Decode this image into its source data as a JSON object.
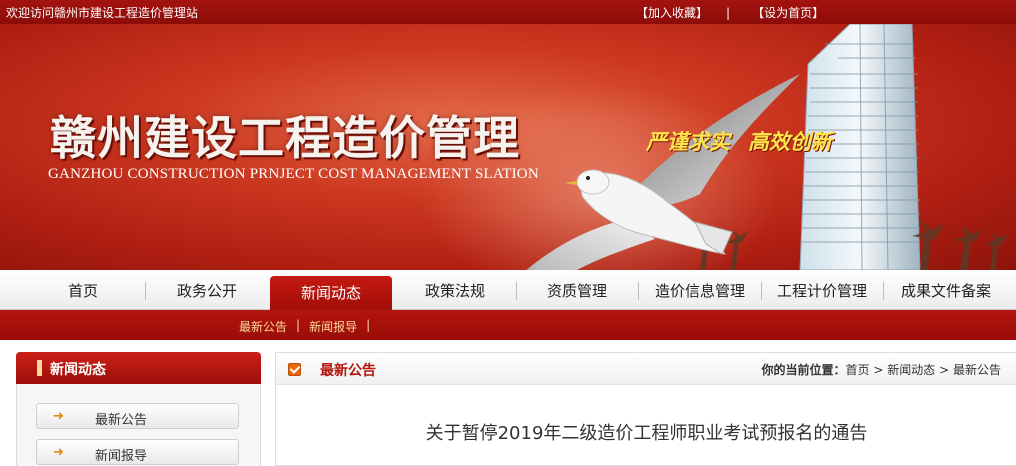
{
  "topbar": {
    "welcome": "欢迎访问赣州市建设工程造价管理站",
    "favorite": "【加入收藏】",
    "separator": "|",
    "homepage": "【设为首页】"
  },
  "banner": {
    "title_cn": "赣州建设工程造价管理",
    "title_en": "GANZHOU CONSTRUCTION PRNJECT COST MANAGEMENT SLATION",
    "slogan_1": "严谨求实",
    "slogan_2": "高效创新"
  },
  "nav": {
    "items": [
      "首页",
      "政务公开",
      "新闻动态",
      "政策法规",
      "资质管理",
      "造价信息管理",
      "工程计价管理",
      "成果文件备案"
    ],
    "active_index": 2
  },
  "subnav": {
    "items": [
      "最新公告",
      "新闻报导"
    ],
    "separator": "|"
  },
  "sidebar": {
    "title": "新闻动态",
    "items": [
      "最新公告",
      "新闻报导"
    ],
    "arrow": "➜"
  },
  "content": {
    "title": "最新公告",
    "breadcrumb_label": "你的当前位置：",
    "breadcrumb": [
      "首页",
      "新闻动态",
      "最新公告"
    ],
    "crumb_sep": ">",
    "article_title": "关于暂停2019年二级造价工程师职业考试预报名的通告"
  },
  "colors": {
    "brand_red": "#b3140e",
    "slogan_yellow": "#ffe34a",
    "checkbox_orange": "#e9680e"
  },
  "icons": [
    "checkbox-icon",
    "arrow-right-icon",
    "seagull-image",
    "tower-image"
  ]
}
